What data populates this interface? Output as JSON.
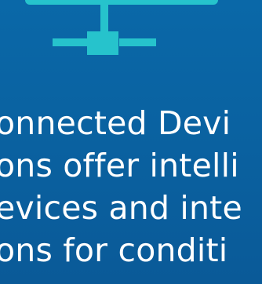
{
  "hero": {
    "icon_name": "connected-devices-icon",
    "lines": [
      "onnected Devi",
      "ons offer intelli",
      "evices and inte",
      "ons for conditi"
    ]
  }
}
